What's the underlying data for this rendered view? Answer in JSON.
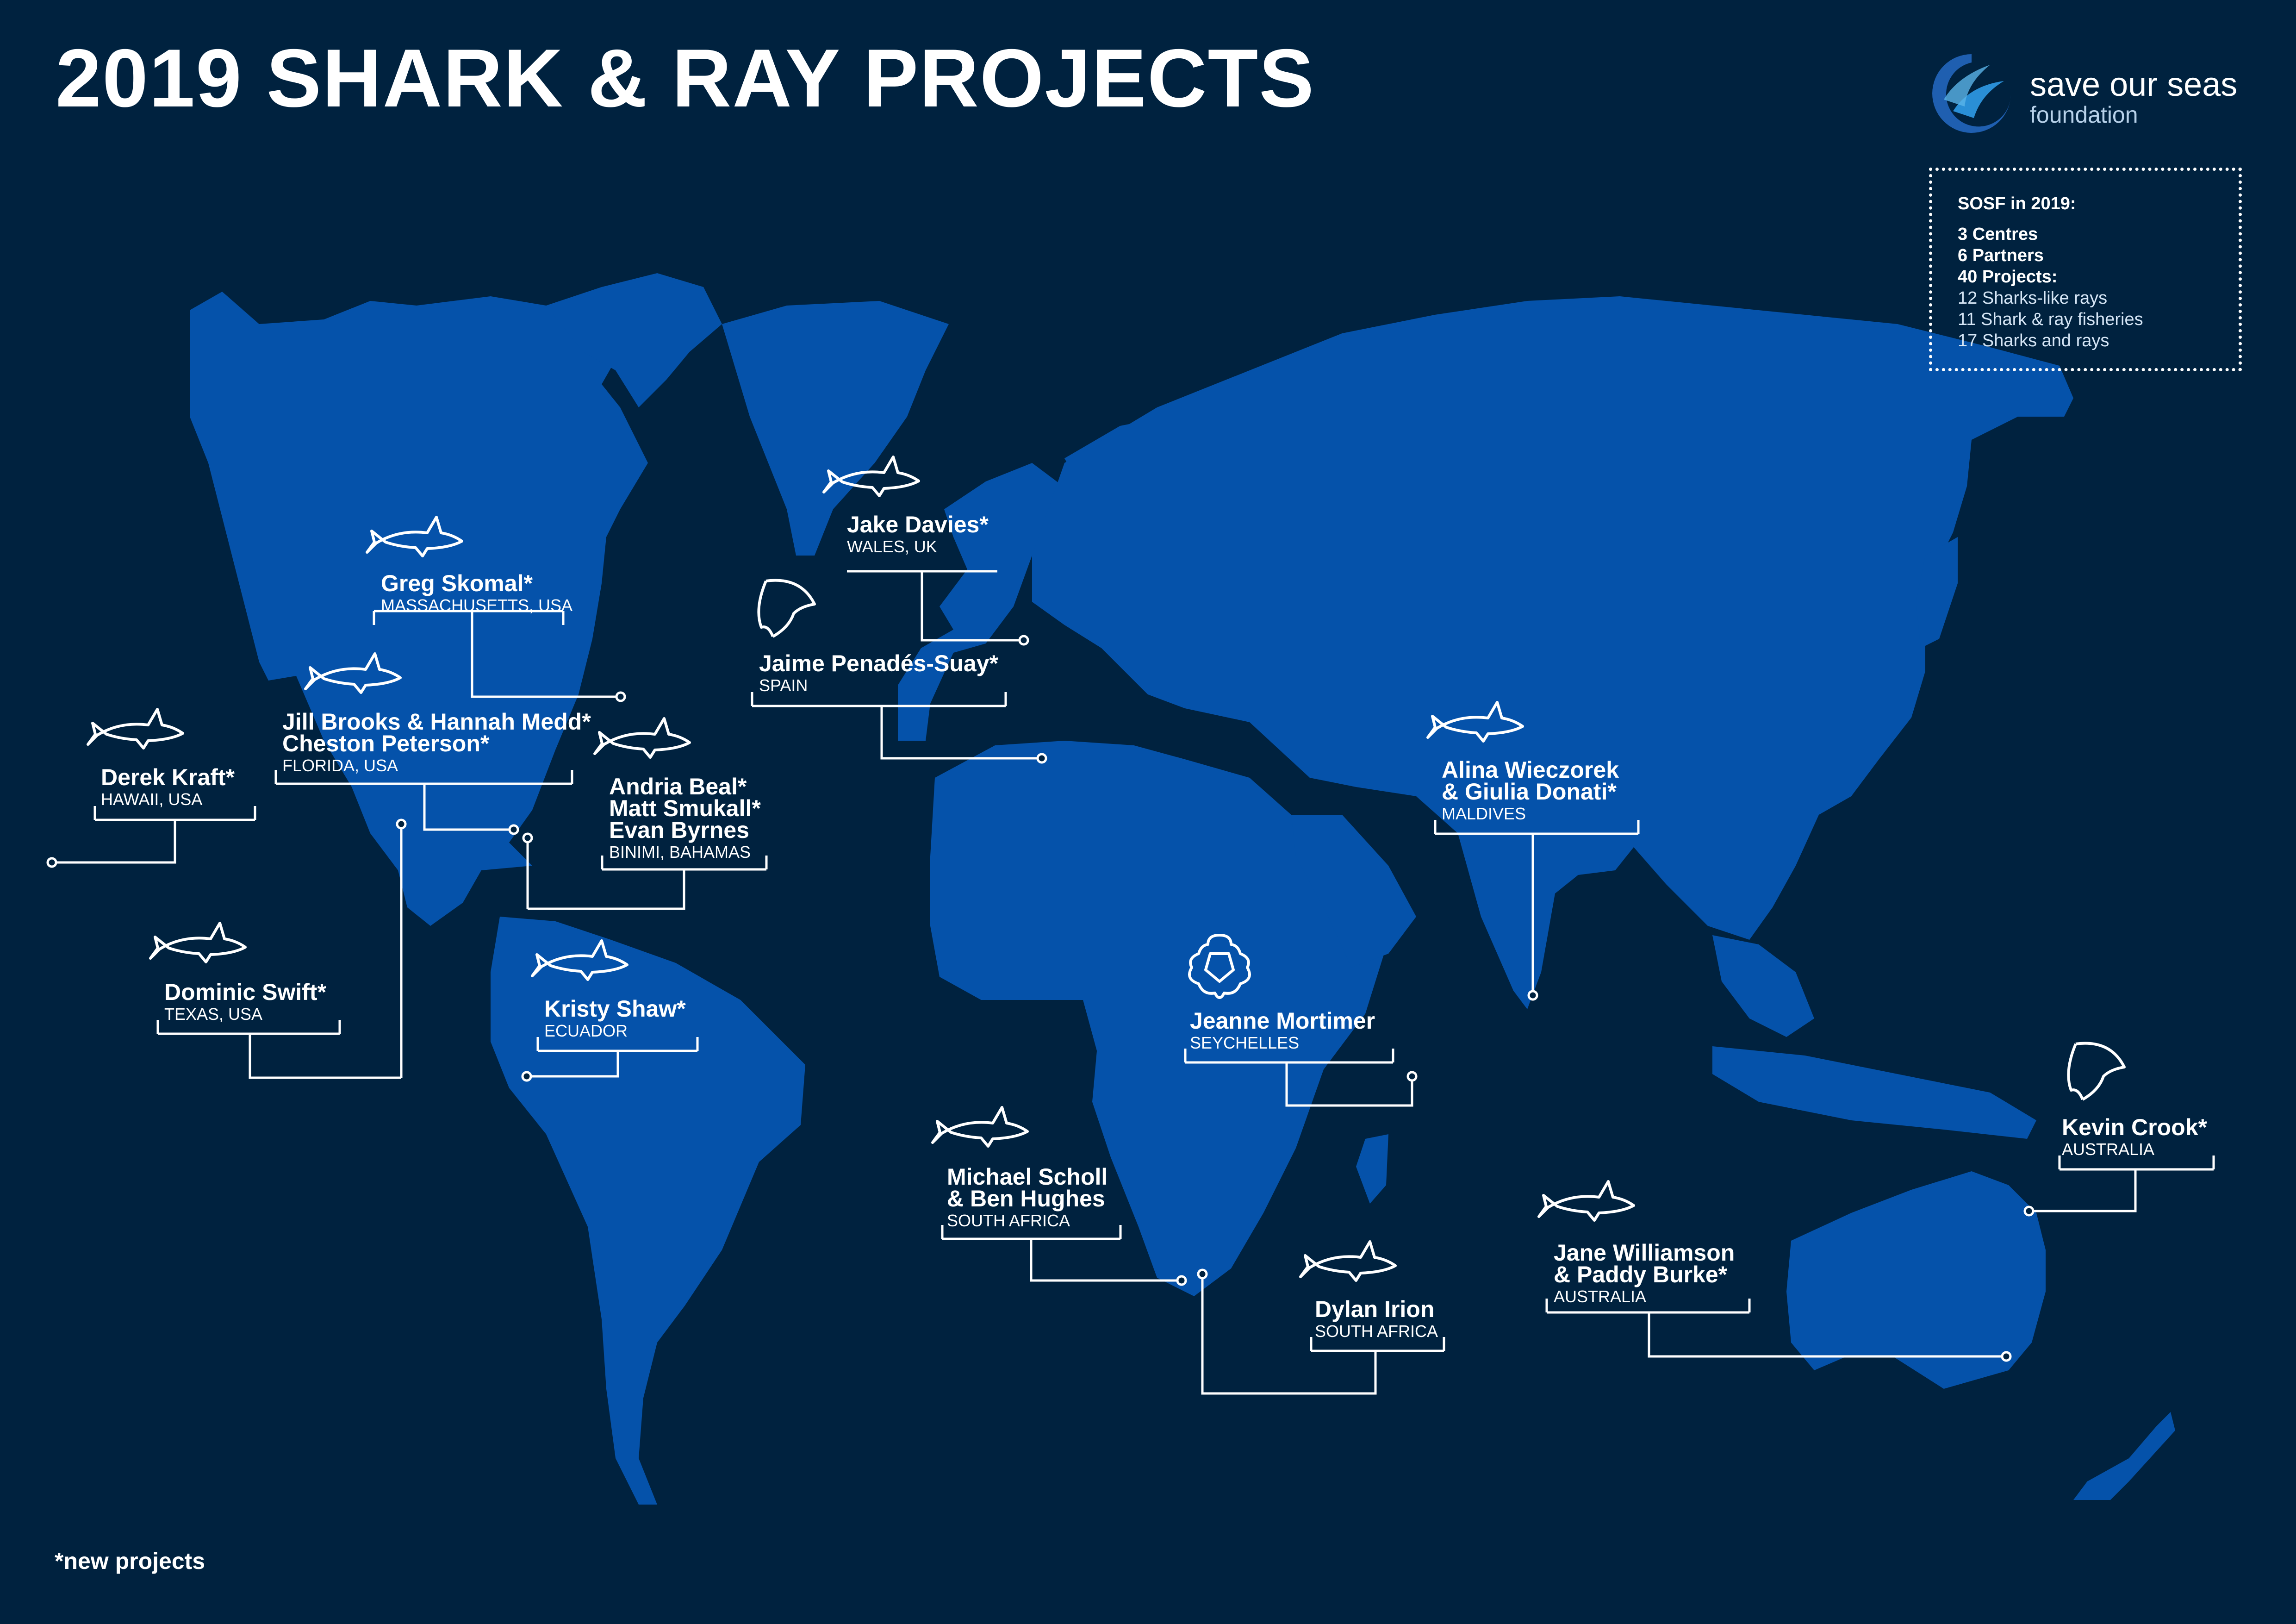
{
  "header": {
    "title": "2019 SHARK & RAY PROJECTS"
  },
  "logo": {
    "name": "save our seas",
    "sub": "foundation"
  },
  "stats": {
    "heading": "SOSF in 2019:",
    "lines": [
      "3 Centres",
      "6 Partners",
      "40 Projects:",
      "12 Sharks-like rays",
      "11 Shark & ray fisheries",
      "17 Sharks and rays"
    ]
  },
  "footnote": "*new projects",
  "colors": {
    "background": "#00223f",
    "land": "#0552aa",
    "text": "#ffffff",
    "logo_accent": "#2a8fd6"
  },
  "projects": [
    {
      "names": [
        "Jake Davies*"
      ],
      "location": "WALES, UK",
      "icon": "shark-icon"
    },
    {
      "names": [
        "Greg Skomal*"
      ],
      "location": "MASSACHUSETTS, USA",
      "icon": "shark-icon"
    },
    {
      "names": [
        "Jaime Penadés-Suay*"
      ],
      "location": "SPAIN",
      "icon": "ray-icon"
    },
    {
      "names": [
        "Jill Brooks & Hannah Medd*",
        "Cheston Peterson*"
      ],
      "location": "FLORIDA, USA",
      "icon": "shark-icon"
    },
    {
      "names": [
        "Derek Kraft*"
      ],
      "location": "HAWAII, USA",
      "icon": "shark-icon"
    },
    {
      "names": [
        "Andria Beal*",
        "Matt Smukall*",
        "Evan Byrnes"
      ],
      "location": "BINIMI, BAHAMAS",
      "icon": "shark-icon"
    },
    {
      "names": [
        "Alina Wieczorek",
        "& Giulia Donati*"
      ],
      "location": "MALDIVES",
      "icon": "shark-icon"
    },
    {
      "names": [
        "Dominic Swift*"
      ],
      "location": "TEXAS, USA",
      "icon": "shark-icon"
    },
    {
      "names": [
        "Kristy Shaw*"
      ],
      "location": "ECUADOR",
      "icon": "shark-icon"
    },
    {
      "names": [
        "Jeanne Mortimer"
      ],
      "location": "SEYCHELLES",
      "icon": "turtle-icon"
    },
    {
      "names": [
        "Kevin Crook*"
      ],
      "location": "AUSTRALIA",
      "icon": "ray-icon"
    },
    {
      "names": [
        "Michael Scholl",
        "& Ben Hughes"
      ],
      "location": "SOUTH AFRICA",
      "icon": "shark-icon"
    },
    {
      "names": [
        "Jane Williamson",
        "& Paddy Burke*"
      ],
      "location": "AUSTRALIA",
      "icon": "shark-icon"
    },
    {
      "names": [
        "Dylan Irion"
      ],
      "location": "SOUTH AFRICA",
      "icon": "shark-icon"
    }
  ]
}
